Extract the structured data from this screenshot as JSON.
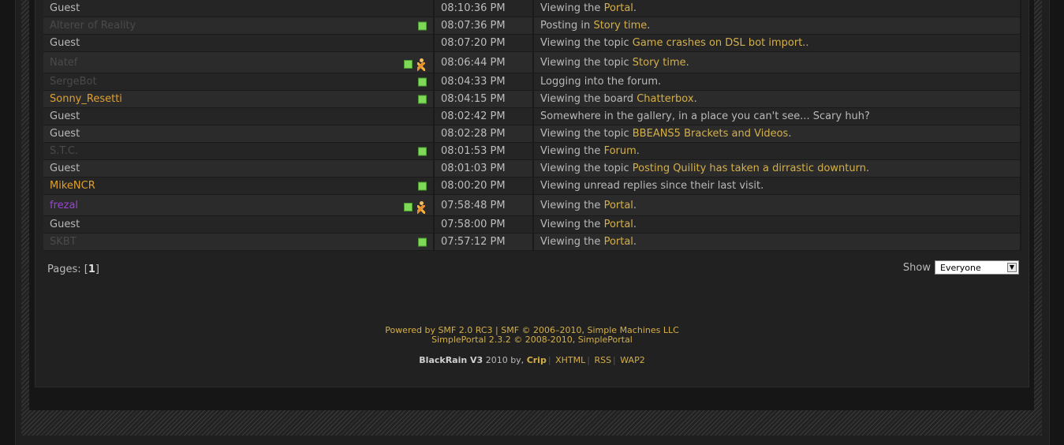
{
  "rows": [
    {
      "name": "Guest",
      "style": "guest",
      "online": false,
      "walker": false,
      "time": "08:10:36 PM",
      "action": "Viewing the",
      "link": "Portal",
      "suffix": "."
    },
    {
      "name": "Alterer of Reality",
      "style": "offline",
      "online": true,
      "walker": false,
      "time": "08:07:36 PM",
      "action": "Posting in",
      "link": "Story time",
      "suffix": "."
    },
    {
      "name": "Guest",
      "style": "guest",
      "online": false,
      "walker": false,
      "time": "08:07:20 PM",
      "action": "Viewing the topic",
      "link": "Game crashes on DSL bot import..",
      "suffix": ""
    },
    {
      "name": "Natef",
      "style": "offline",
      "online": true,
      "walker": true,
      "time": "08:06:44 PM",
      "action": "Viewing the topic",
      "link": "Story time",
      "suffix": "."
    },
    {
      "name": "SergeBot",
      "style": "offline",
      "online": true,
      "walker": false,
      "time": "08:04:33 PM",
      "action": "Logging into the forum.",
      "link": "",
      "suffix": ""
    },
    {
      "name": "Sonny_Resetti",
      "style": "orange",
      "online": true,
      "walker": false,
      "time": "08:04:15 PM",
      "action": "Viewing the board",
      "link": "Chatterbox",
      "suffix": "."
    },
    {
      "name": "Guest",
      "style": "guest",
      "online": false,
      "walker": false,
      "time": "08:02:42 PM",
      "action": "Somewhere in the gallery, in a place you can't see... Scary huh?",
      "link": "",
      "suffix": ""
    },
    {
      "name": "Guest",
      "style": "guest",
      "online": false,
      "walker": false,
      "time": "08:02:28 PM",
      "action": "Viewing the topic",
      "link": "BBEANS5 Brackets and Videos",
      "suffix": "."
    },
    {
      "name": "S.T.C.",
      "style": "offline",
      "online": true,
      "walker": false,
      "time": "08:01:53 PM",
      "action": "Viewing the",
      "link": "Forum",
      "suffix": "."
    },
    {
      "name": "Guest",
      "style": "guest",
      "online": false,
      "walker": false,
      "time": "08:01:03 PM",
      "action": "Viewing the topic",
      "link": "Posting Quility has taken a dirrastic downturn",
      "suffix": "."
    },
    {
      "name": "MikeNCR",
      "style": "orange",
      "online": true,
      "walker": false,
      "time": "08:00:20 PM",
      "action": "Viewing unread replies since their last visit.",
      "link": "",
      "suffix": ""
    },
    {
      "name": "frezal",
      "style": "purple",
      "online": true,
      "walker": true,
      "time": "07:58:48 PM",
      "action": "Viewing the",
      "link": "Portal",
      "suffix": "."
    },
    {
      "name": "Guest",
      "style": "guest",
      "online": false,
      "walker": false,
      "time": "07:58:00 PM",
      "action": "Viewing the",
      "link": "Portal",
      "suffix": "."
    },
    {
      "name": "SKBT",
      "style": "offline",
      "online": true,
      "walker": false,
      "time": "07:57:12 PM",
      "action": "Viewing the",
      "link": "Portal",
      "suffix": "."
    }
  ],
  "pagination": {
    "label": "Pages: [",
    "current": "1",
    "close": "]"
  },
  "show": {
    "label": "Show",
    "selected": "Everyone"
  },
  "footer": {
    "powered_by": "Powered by SMF 2.0 RC3",
    "copyright": "SMF © 2006–2010, Simple Machines LLC",
    "portal": "SimplePortal 2.3.2 © 2008-2010, SimplePortal",
    "theme_name": "BlackRain V3",
    "theme_year_by": "2010 by,",
    "theme_author": "Crip",
    "links": [
      "XHTML",
      "RSS",
      "WAP2"
    ]
  },
  "colors": {
    "link": "#d4b04a",
    "member_orange": "#e0a030",
    "member_purple": "#9b44d6",
    "online_green": "#7ed957"
  }
}
